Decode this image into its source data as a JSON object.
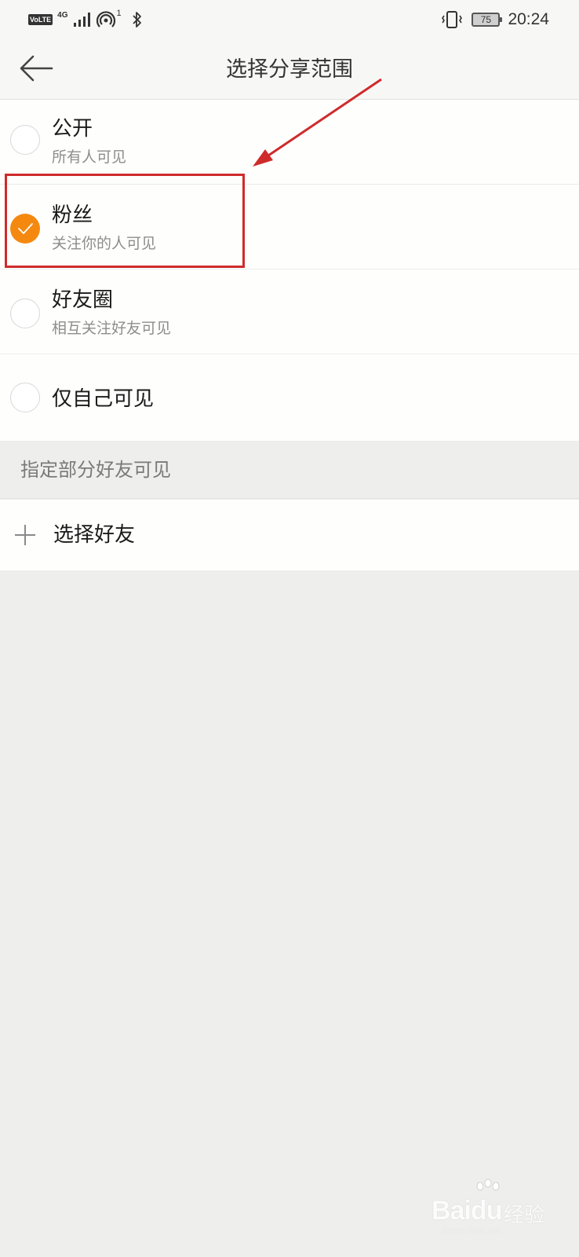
{
  "status_bar": {
    "volte": "VoLTE",
    "network": "4G",
    "hotspot_count": "1",
    "battery": "75",
    "time": "20:24"
  },
  "header": {
    "title": "选择分享范围"
  },
  "options": [
    {
      "label": "公开",
      "sub": "所有人可见",
      "selected": false
    },
    {
      "label": "粉丝",
      "sub": "关注你的人可见",
      "selected": true
    },
    {
      "label": "好友圈",
      "sub": "相互关注好友可见",
      "selected": false
    },
    {
      "label": "仅自己可见",
      "sub": "",
      "selected": false
    }
  ],
  "section": {
    "title": "指定部分好友可见"
  },
  "select_friends": {
    "label": "选择好友"
  },
  "watermark": {
    "logo": "Bai",
    "logo_suffix": "du",
    "jingyan": "经验",
    "url": "jingyan.baidu.com"
  },
  "colors": {
    "accent": "#f5890f",
    "annotation": "#cf2b2b",
    "background": "#eeeeed"
  }
}
